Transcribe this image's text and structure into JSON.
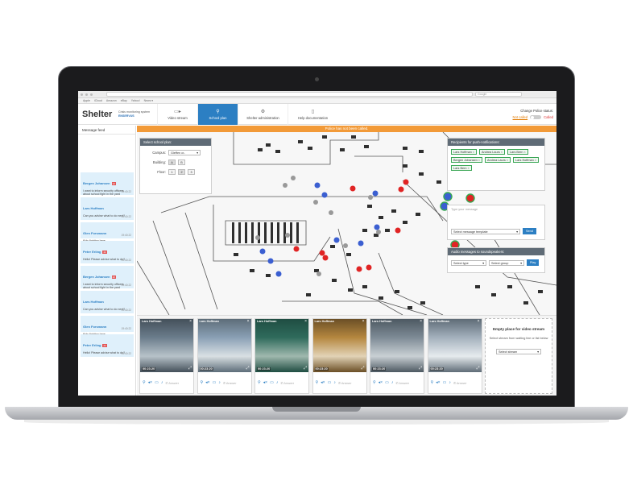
{
  "browser": {
    "search_placeholder": "Google",
    "bookmarks": [
      "Apple",
      "iCloud",
      "Amazon",
      "eBay",
      "Yahoo!",
      "News ▾"
    ]
  },
  "header": {
    "brand": "Shelter",
    "tagline": "Crisis monitoring system",
    "logo_text": "ENSERVUS",
    "nav": [
      {
        "label": "Video stream",
        "icon": "video-camera-icon"
      },
      {
        "label": "School plan",
        "icon": "map-pin-icon"
      },
      {
        "label": "Shelter administration",
        "icon": "sliders-icon"
      },
      {
        "label": "Help documentation",
        "icon": "document-icon"
      }
    ],
    "active_nav": "School plan",
    "police_status_label": "Change Police status:",
    "not_called": "Not called",
    "called": "Called"
  },
  "feed": {
    "title": "Message feed",
    "messages": [
      {
        "name": "Bergen Johansen",
        "badge": "22",
        "text": "I want to inform security officers about school fight in the yard",
        "time": "19:40:22"
      },
      {
        "name": "Lars Hoffman",
        "badge": "",
        "text": "Can you advise what to do next?",
        "time": "19:40:22"
      },
      {
        "name": "Glen Forsmann",
        "badge": "",
        "text": "Kids fighting here",
        "time": "19:40:22"
      },
      {
        "name": "Peter Erling",
        "badge": "22",
        "text": "Hello! Please advise what to do?",
        "time": "19:40:22"
      },
      {
        "name": "Bergen Johansen",
        "badge": "22",
        "text": "I want to inform security officers about school fight in the yard",
        "time": "19:40:22"
      },
      {
        "name": "Lars Hoffman",
        "badge": "",
        "text": "Can you advise what to do next?",
        "time": "19:40:22"
      },
      {
        "name": "Glen Forsmann",
        "badge": "",
        "text": "Kids fighting here",
        "time": "19:40:22"
      },
      {
        "name": "Peter Erling",
        "badge": "22",
        "text": "Hello! Please advise what to do?",
        "time": "19:40:22"
      }
    ]
  },
  "banner": "Police has not been called.",
  "school_plan": {
    "title": "Select school plan:",
    "campus_label": "Campus:",
    "campus_value": "Gleffen cr..",
    "building_label": "Building:",
    "buildings": [
      "A",
      "B"
    ],
    "floor_label": "Floor:",
    "floors": [
      "1",
      "2",
      "3"
    ]
  },
  "recipients": {
    "title": "Recipients for push-notifications:",
    "chips": [
      "Lars Hoffman",
      "Andrea Laurs",
      "Lars Bern",
      "Bergen Johansen",
      "Andrea Laurs",
      "Lars Hoffman",
      "Lars Bern"
    ],
    "message_placeholder": "Type your message",
    "template_placeholder": "Select message template",
    "send": "Send"
  },
  "audio": {
    "title": "Audio messages to soundspeakers:",
    "type_placeholder": "Select type",
    "group_placeholder": "Select group",
    "play": "Play"
  },
  "cameras": [
    {
      "name": "Lars Hoffman",
      "time": "00:23:20",
      "answer": "Answer"
    },
    {
      "name": "Lars Hoffman",
      "time": "00:23:20",
      "answer": "Answer"
    },
    {
      "name": "Lars Hoffman",
      "time": "00:23:20",
      "answer": "Answer"
    },
    {
      "name": "Lars Hoffman",
      "time": "00:23:20",
      "answer": "Answer"
    },
    {
      "name": "Lars Hoffman",
      "time": "00:23:20",
      "answer": "Answer"
    },
    {
      "name": "Lars Hoffman",
      "time": "00:23:20",
      "answer": "Answer"
    }
  ],
  "empty_slot": {
    "title": "Empty place for video stream",
    "hint": "Select stream from waiting line or list below",
    "select_placeholder": "Select stream"
  },
  "colors": {
    "accent": "#2c7fc3",
    "banner": "#f29a38",
    "red_marker": "#e02424",
    "blue_marker": "#3b5fd1",
    "chip_border": "#3aa655"
  }
}
